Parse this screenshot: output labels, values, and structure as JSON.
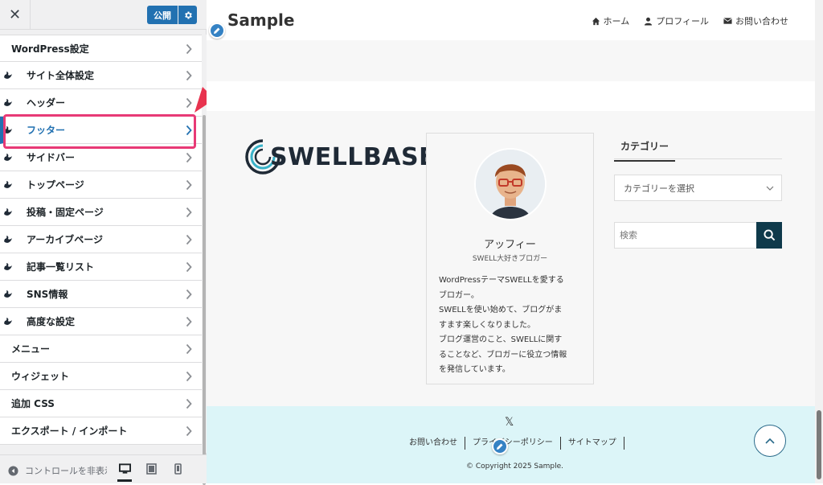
{
  "customizer": {
    "close_symbol": "✕",
    "publish_label": "公開",
    "menu": [
      {
        "label": "WordPress設定",
        "swell": false
      },
      {
        "label": "サイト全体設定",
        "swell": true
      },
      {
        "label": "ヘッダー",
        "swell": true
      },
      {
        "label": "フッター",
        "swell": true,
        "active": true
      },
      {
        "label": "サイドバー",
        "swell": true
      },
      {
        "label": "トップページ",
        "swell": true
      },
      {
        "label": "投稿・固定ページ",
        "swell": true
      },
      {
        "label": "アーカイブページ",
        "swell": true
      },
      {
        "label": "記事一覧リスト",
        "swell": true
      },
      {
        "label": "SNS情報",
        "swell": true
      },
      {
        "label": "高度な設定",
        "swell": true
      },
      {
        "label": "メニュー",
        "swell": false
      },
      {
        "label": "ウィジェット",
        "swell": false
      },
      {
        "label": "追加 CSS",
        "swell": false
      },
      {
        "label": "エクスポート / インポート",
        "swell": false
      }
    ],
    "collapse_label": "コントロールを非表示",
    "accent_color": "#2271b1",
    "highlight_color": "#e83a76"
  },
  "site": {
    "title": "Sample",
    "nav": [
      {
        "label": "ホーム",
        "icon": "home-icon"
      },
      {
        "label": "プロフィール",
        "icon": "user-icon"
      },
      {
        "label": "お問い合わせ",
        "icon": "mail-icon"
      }
    ],
    "logo_text": "SWELLBASE",
    "profile": {
      "name": "アッフィー",
      "tagline": "SWELL大好きブロガー",
      "bio": [
        "WordPressテーマSWELLを愛する",
        "ブロガー。",
        "SWELLを使い始めて、ブログがま",
        "すます楽しくなりました。",
        "ブログ運営のこと、SWELLに関す",
        "ることなど、ブロガーに役立つ情報",
        "を発信しています。"
      ]
    },
    "category_widget": {
      "title": "カテゴリー",
      "select_value": "カテゴリーを選択"
    },
    "search": {
      "placeholder": "検索"
    },
    "footer": {
      "x_symbol": "𝕏",
      "links": [
        "お問い合わせ",
        "プライバシーポリシー",
        "サイトマップ"
      ],
      "copyright": "© Copyright 2025 Sample."
    }
  }
}
